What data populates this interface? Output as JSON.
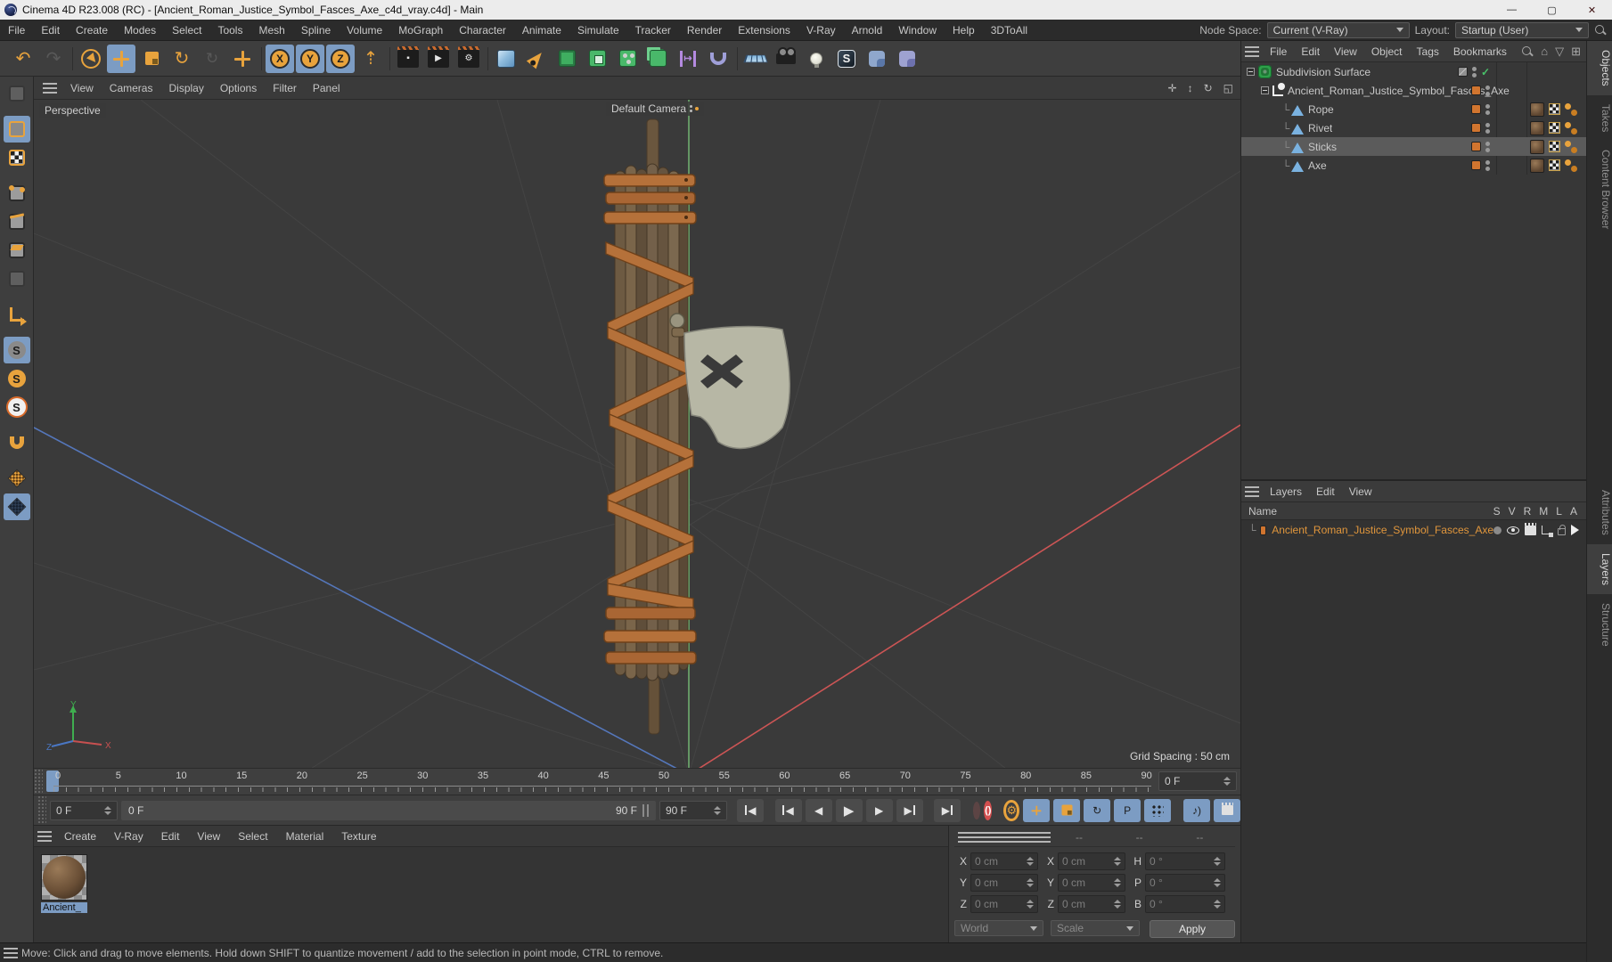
{
  "window": {
    "title": "Cinema 4D R23.008 (RC) - [Ancient_Roman_Justice_Symbol_Fasces_Axe_c4d_vray.c4d] - Main",
    "controls": {
      "minimize": "—",
      "maximize": "▢",
      "close": "✕"
    }
  },
  "menubar": {
    "items": [
      "File",
      "Edit",
      "Create",
      "Modes",
      "Select",
      "Tools",
      "Mesh",
      "Spline",
      "Volume",
      "MoGraph",
      "Character",
      "Animate",
      "Simulate",
      "Tracker",
      "Render",
      "Extensions",
      "V-Ray",
      "Arnold",
      "Window",
      "Help",
      "3DToAll"
    ],
    "node_space_label": "Node Space:",
    "node_space_value": "Current (V-Ray)",
    "layout_label": "Layout:",
    "layout_value": "Startup (User)"
  },
  "toolbar": {
    "x_label": "X",
    "y_label": "Y",
    "z_label": "Z"
  },
  "viewport": {
    "menu": [
      "View",
      "Cameras",
      "Display",
      "Options",
      "Filter",
      "Panel"
    ],
    "view_label": "Perspective",
    "camera_label": "Default Camera",
    "grid_spacing": "Grid Spacing : 50 cm",
    "gizmo": {
      "x": "X",
      "y": "Y",
      "z": "Z"
    }
  },
  "object_manager": {
    "menu": [
      "File",
      "Edit",
      "View",
      "Object",
      "Tags",
      "Bookmarks"
    ],
    "tree": [
      {
        "label": "Subdivision Surface"
      },
      {
        "label": "Ancient_Roman_Justice_Symbol_Fasces_Axe"
      },
      {
        "label": "Rope"
      },
      {
        "label": "Rivet"
      },
      {
        "label": "Sticks"
      },
      {
        "label": "Axe"
      }
    ]
  },
  "layers_panel": {
    "menu": [
      "Layers",
      "Edit",
      "View"
    ],
    "name_header": "Name",
    "columns": [
      "S",
      "V",
      "R",
      "M",
      "L",
      "A"
    ],
    "rows": [
      {
        "label": "Ancient_Roman_Justice_Symbol_Fasces_Axe"
      }
    ]
  },
  "right_tabs_top": [
    {
      "label": "Objects",
      "active": true
    },
    {
      "label": "Takes"
    },
    {
      "label": "Content Browser"
    }
  ],
  "right_tabs_bottom": [
    {
      "label": "Attributes"
    },
    {
      "label": "Layers",
      "active": true
    },
    {
      "label": "Structure"
    }
  ],
  "timeline": {
    "ticks": [
      0,
      5,
      10,
      15,
      20,
      25,
      30,
      35,
      40,
      45,
      50,
      55,
      60,
      65,
      70,
      75,
      80,
      85,
      90
    ],
    "frame_field": "0 F",
    "start_field": "0 F",
    "range_start": "0 F",
    "range_end": "90 F",
    "end_field": "90 F",
    "p_label": "P",
    "record_brackets": "()"
  },
  "material_manager": {
    "menu": [
      "Create",
      "V-Ray",
      "Edit",
      "View",
      "Select",
      "Material",
      "Texture"
    ],
    "materials": [
      {
        "name": "Ancient_"
      }
    ]
  },
  "coordinates": {
    "headers": [
      "--",
      "--",
      "--"
    ],
    "rows": [
      {
        "l1": "X",
        "v1": "0 cm",
        "l2": "X",
        "v2": "0 cm",
        "l3": "H",
        "v3": "0 °"
      },
      {
        "l1": "Y",
        "v1": "0 cm",
        "l2": "Y",
        "v2": "0 cm",
        "l3": "P",
        "v3": "0 °"
      },
      {
        "l1": "Z",
        "v1": "0 cm",
        "l2": "Z",
        "v2": "0 cm",
        "l3": "B",
        "v3": "0 °"
      }
    ],
    "space_dropdown": "World",
    "scale_dropdown": "Scale",
    "apply_label": "Apply"
  },
  "status_bar": {
    "text": "Move: Click and drag to move elements. Hold down SHIFT to quantize movement / add to the selection in point mode, CTRL to remove."
  },
  "colors": {
    "accent_blue": "#7c9cc3",
    "accent_orange": "#e8a33d",
    "layer_orange": "#d1752f",
    "axis_x": "#cc5555",
    "axis_y": "#6fae6f",
    "axis_z": "#5577bb",
    "viewport_bg": "#3a3a3a"
  }
}
